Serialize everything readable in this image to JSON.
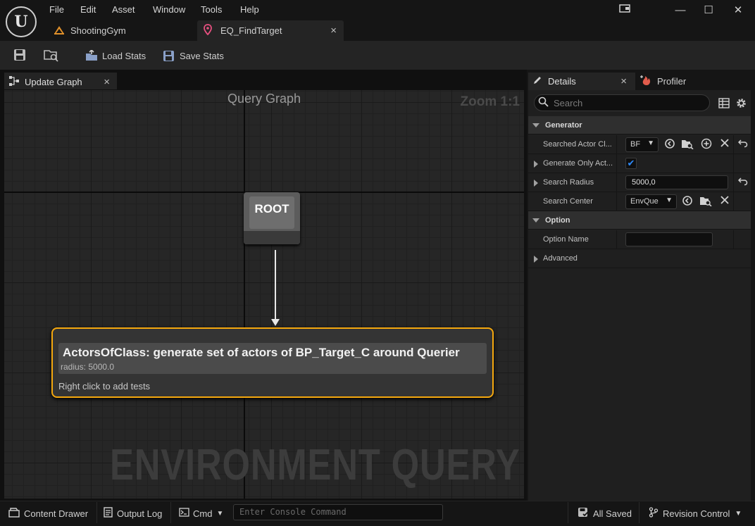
{
  "app": {
    "logo_letter": "U",
    "menu": [
      "File",
      "Edit",
      "Asset",
      "Window",
      "Tools",
      "Help"
    ],
    "tabs": [
      {
        "label": "ShootingGym",
        "icon": "level-icon"
      },
      {
        "label": "EQ_FindTarget",
        "icon": "environment-query-icon",
        "close": "×"
      }
    ],
    "window_buttons": {
      "minimize": "—",
      "maximize": "☐",
      "close": "✕"
    }
  },
  "toolbar": {
    "save_icon": "save-icon",
    "browse_icon": "browse-icon",
    "load_stats": "Load Stats",
    "save_stats": "Save Stats"
  },
  "graph_panel": {
    "tab_label": "Update Graph",
    "tab_close": "×",
    "title": "Query Graph",
    "zoom": "Zoom 1:1",
    "watermark": "ENVIRONMENT QUERY",
    "root_node": {
      "label": "ROOT"
    },
    "generator_node": {
      "title": "ActorsOfClass: generate set of actors of BP_Target_C around Querier",
      "radius": "radius: 5000.0",
      "hint": "Right click to add tests"
    }
  },
  "details": {
    "tab_label": "Details",
    "tab_close": "×",
    "profiler_label": "Profiler",
    "search_placeholder": "Search",
    "categories": {
      "generator": "Generator",
      "option": "Option",
      "advanced": "Advanced"
    },
    "properties": {
      "searched_actor_class": {
        "label": "Searched Actor Cl...",
        "value": "BF"
      },
      "generate_only_actors": {
        "label": "Generate Only Act...",
        "checked": true
      },
      "search_radius": {
        "label": "Search Radius",
        "value": "5000,0"
      },
      "search_center": {
        "label": "Search Center",
        "value": "EnvQue"
      },
      "option_name": {
        "label": "Option Name",
        "value": ""
      }
    }
  },
  "status_bar": {
    "content_drawer": "Content Drawer",
    "output_log": "Output Log",
    "cmd": "Cmd",
    "console_placeholder": "Enter Console Command",
    "all_saved": "All Saved",
    "revision_control": "Revision Control"
  },
  "colors": {
    "accent_selection": "#f5a80e",
    "checkbox": "#2f8cff",
    "background": "#151515"
  }
}
